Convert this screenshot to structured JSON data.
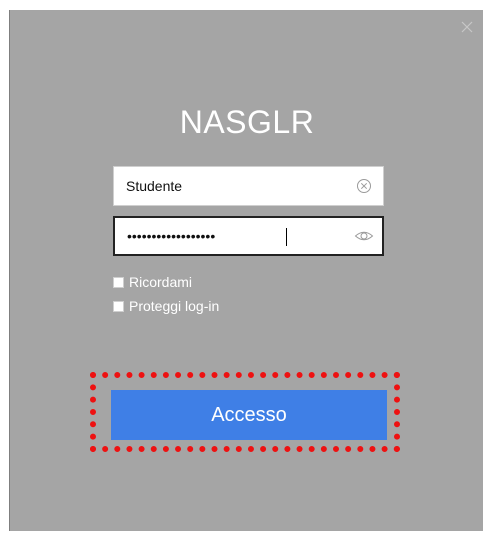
{
  "dialog": {
    "title": "NASGLR",
    "close_icon": "close-icon"
  },
  "username": {
    "value": "Studente",
    "clear_icon": "clear-circle-icon"
  },
  "password": {
    "value": "••••••••••••••••••",
    "reveal_icon": "eye-icon"
  },
  "options": {
    "remember_label": "Ricordami",
    "protect_label": "Proteggi log-in"
  },
  "login_button": {
    "label": "Accesso"
  },
  "colors": {
    "dialog_background": "#a5a5a5",
    "button_accent": "#3f7fe6",
    "highlight": "#ee1111"
  }
}
